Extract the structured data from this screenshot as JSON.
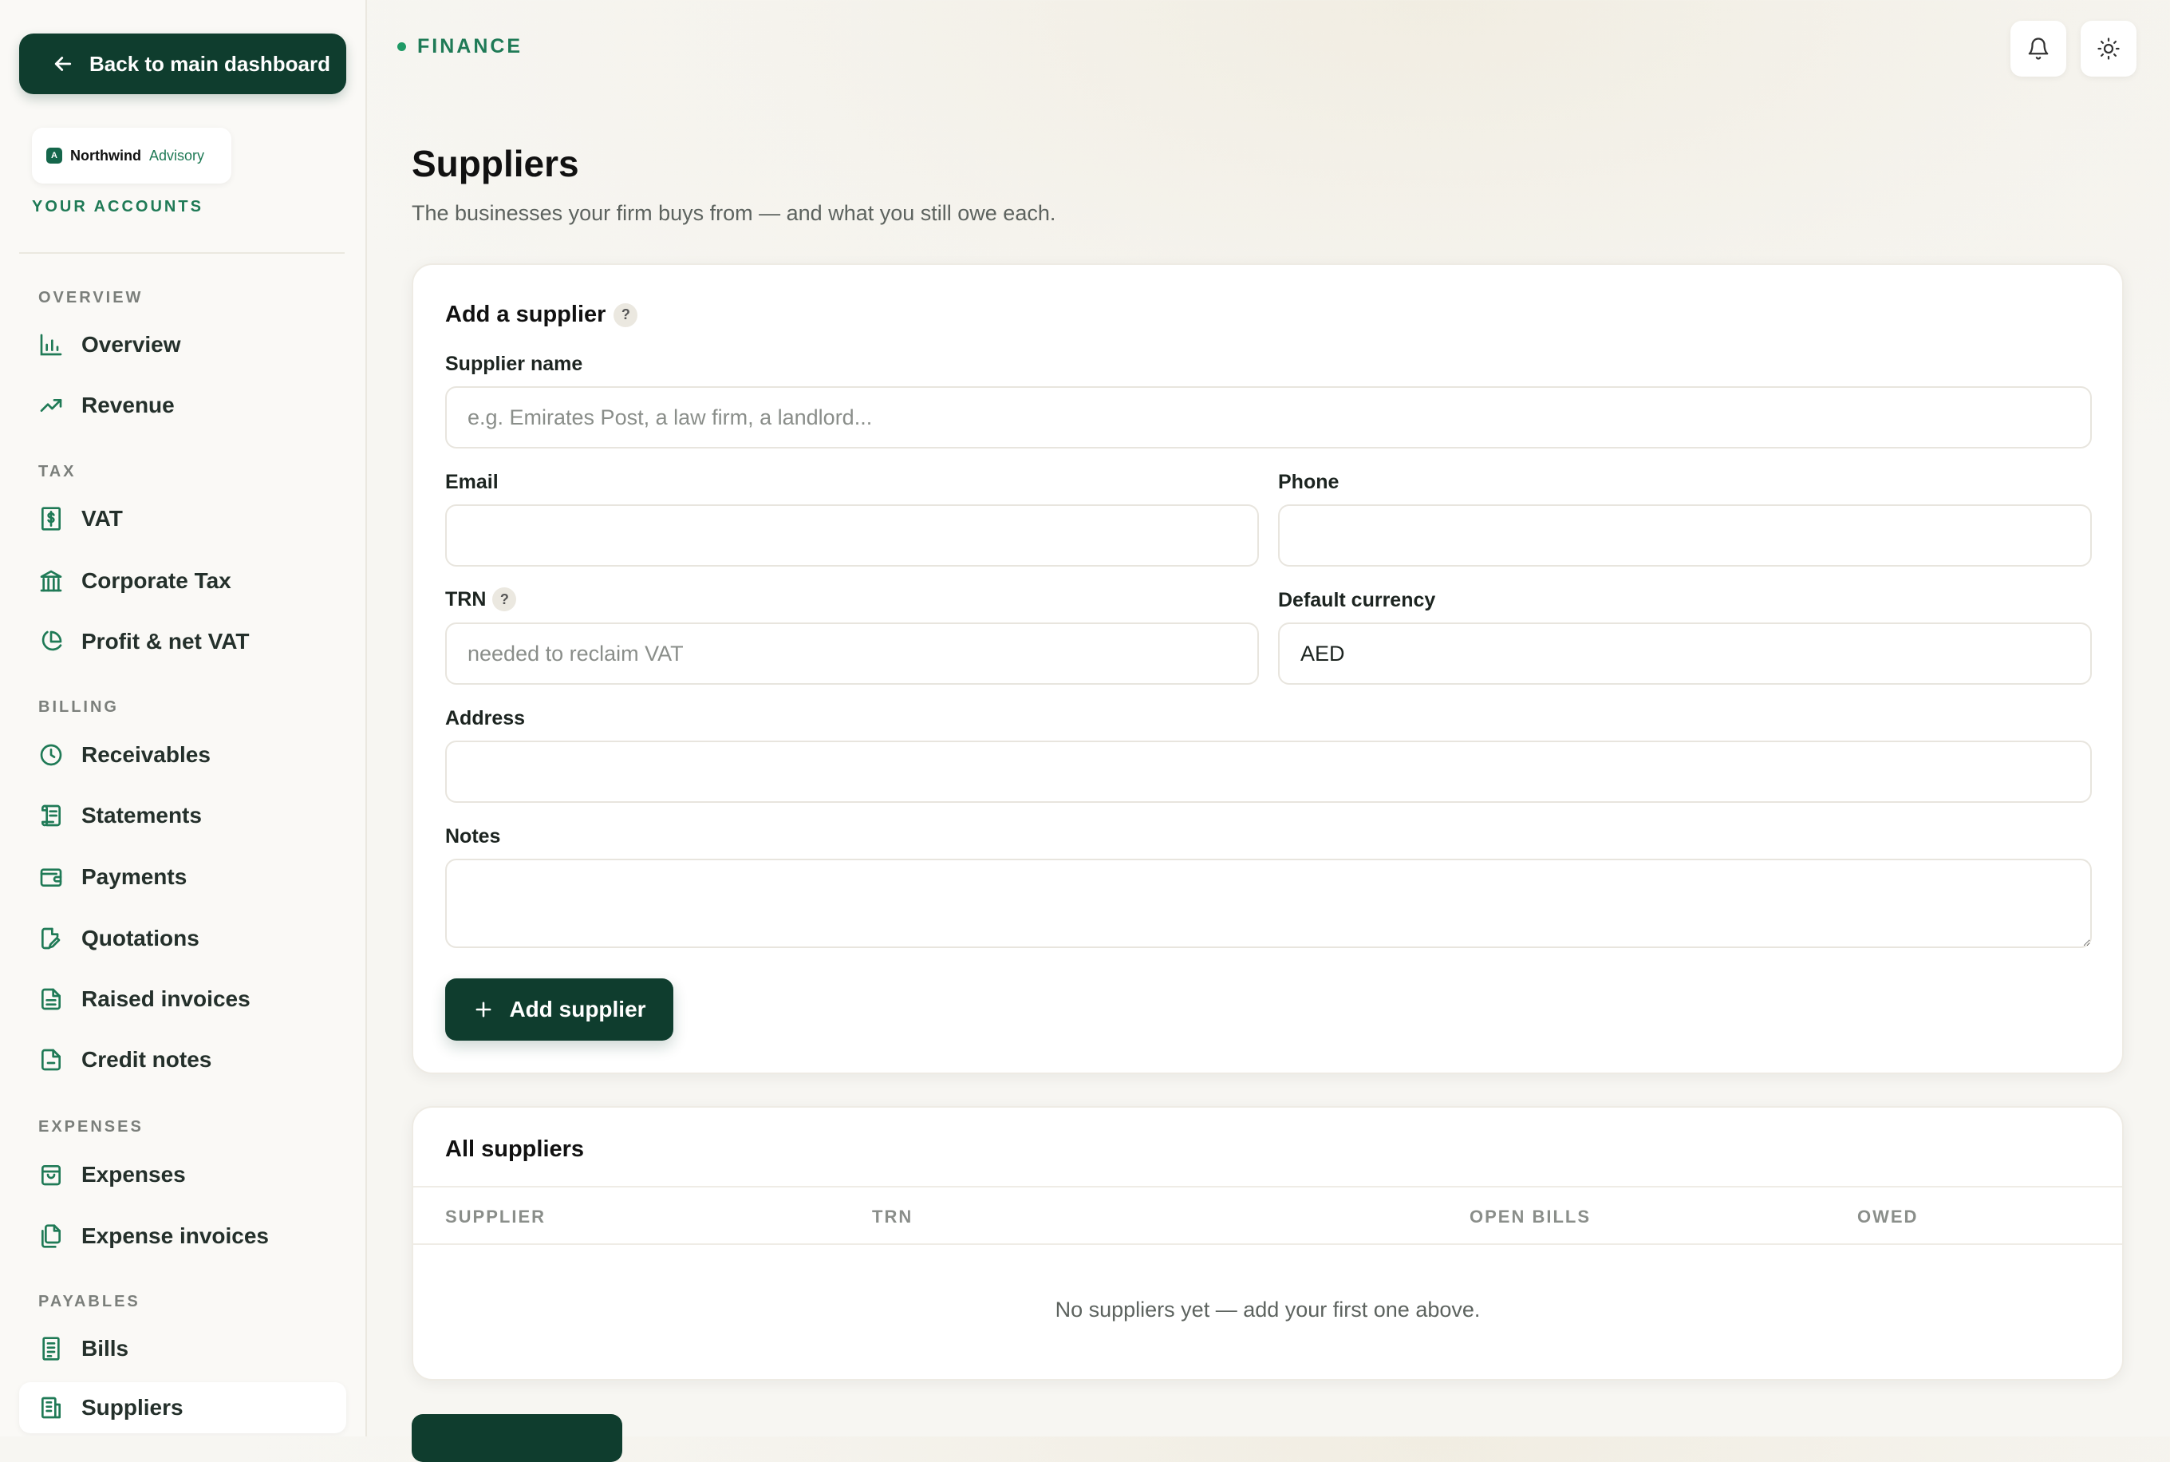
{
  "sidebar": {
    "back_label": "Back to main dashboard",
    "brand": {
      "mark": "A",
      "name": "Northwind",
      "sub": "Advisory"
    },
    "accounts_label": "YOUR ACCOUNTS",
    "sections": {
      "overview": "OVERVIEW",
      "tax": "TAX",
      "billing": "BILLING",
      "expenses": "EXPENSES",
      "payables": "PAYABLES"
    },
    "items": {
      "overview": "Overview",
      "revenue": "Revenue",
      "vat": "VAT",
      "corporate_tax": "Corporate Tax",
      "profit_net_vat": "Profit & net VAT",
      "receivables": "Receivables",
      "statements": "Statements",
      "payments": "Payments",
      "quotations": "Quotations",
      "raised_invoices": "Raised invoices",
      "credit_notes": "Credit notes",
      "expenses": "Expenses",
      "expense_invoices": "Expense invoices",
      "bills": "Bills",
      "suppliers": "Suppliers"
    }
  },
  "header": {
    "section_label": "FINANCE",
    "title": "Suppliers",
    "subtitle": "The businesses your firm buys from — and what you still owe each."
  },
  "icons": {
    "notifications": "bell-icon",
    "theme": "sun-icon"
  },
  "form": {
    "title": "Add a supplier",
    "help_glyph": "?",
    "supplier_name": {
      "label": "Supplier name",
      "placeholder": "e.g. Emirates Post, a law firm, a landlord..."
    },
    "email": {
      "label": "Email",
      "value": ""
    },
    "phone": {
      "label": "Phone",
      "value": ""
    },
    "trn": {
      "label": "TRN",
      "placeholder": "needed to reclaim VAT"
    },
    "currency": {
      "label": "Default currency",
      "value": "AED"
    },
    "address": {
      "label": "Address",
      "value": ""
    },
    "notes": {
      "label": "Notes",
      "value": ""
    },
    "submit_label": "Add supplier"
  },
  "table": {
    "title": "All suppliers",
    "columns": [
      "SUPPLIER",
      "TRN",
      "OPEN BILLS",
      "OWED"
    ],
    "empty_message": "No suppliers yet — add your first one above."
  },
  "colors": {
    "accent": "#0f3d2e",
    "accent_text": "#1f7a56"
  }
}
